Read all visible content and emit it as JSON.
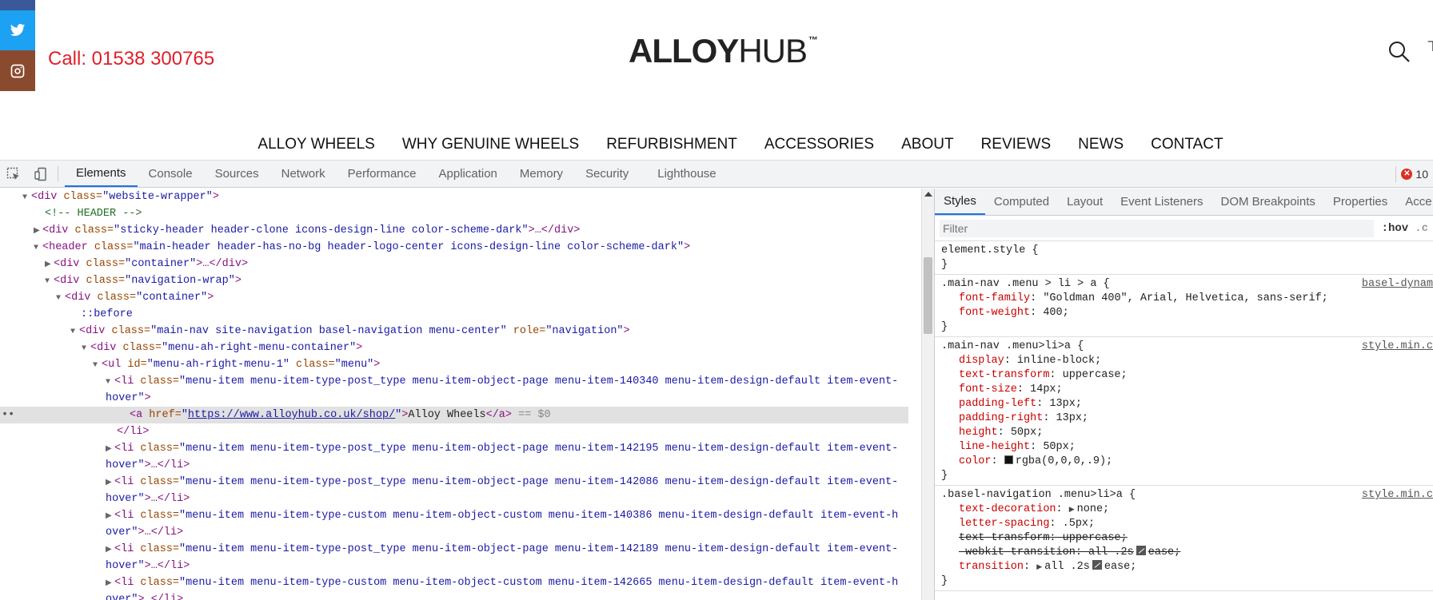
{
  "site": {
    "call_text": "Call: 01538 300765",
    "logo": {
      "bold": "ALLOY",
      "light": "HUB",
      "tm": "™"
    },
    "nav": [
      "ALLOY WHEELS",
      "WHY GENUINE WHEELS",
      "REFURBISHMENT",
      "ACCESSORIES",
      "ABOUT",
      "REVIEWS",
      "NEWS",
      "CONTACT"
    ],
    "social_icons": [
      "facebook-icon",
      "twitter-icon",
      "instagram-icon"
    ]
  },
  "devtools": {
    "tabs": [
      "Elements",
      "Console",
      "Sources",
      "Network",
      "Performance",
      "Application",
      "Memory",
      "Security",
      "Lighthouse"
    ],
    "active_tab": "Elements",
    "error_count": "10",
    "dom": {
      "l1": {
        "tag": "<div",
        "a1": " class=",
        "v1": "\"website-wrapper\"",
        "end": ">"
      },
      "l2": {
        "comment": "<!-- HEADER -->"
      },
      "l3": {
        "tag": "<div",
        "a1": " class=",
        "v1": "\"sticky-header header-clone icons-design-line color-scheme-dark\"",
        "end": ">…</div>"
      },
      "l4": {
        "tag": "<header",
        "a1": " class=",
        "v1": "\"main-header header-has-no-bg header-logo-center icons-design-line color-scheme-dark\"",
        "end": ">"
      },
      "l5": {
        "tag": "<div",
        "a1": " class=",
        "v1": "\"container\"",
        "end": ">…</div>"
      },
      "l6": {
        "tag": "<div",
        "a1": " class=",
        "v1": "\"navigation-wrap\"",
        "end": ">"
      },
      "l7": {
        "tag": "<div",
        "a1": " class=",
        "v1": "\"container\"",
        "end": ">"
      },
      "l8": {
        "pseudo": "::before"
      },
      "l9": {
        "tag": "<div",
        "a1": " class=",
        "v1": "\"main-nav site-navigation basel-navigation menu-center\"",
        "a2": " role=",
        "v2": "\"navigation\"",
        "end": ">"
      },
      "l10": {
        "tag": "<div",
        "a1": " class=",
        "v1": "\"menu-ah-right-menu-container\"",
        "end": ">"
      },
      "l11": {
        "tag": "<ul",
        "a1": " id=",
        "v1": "\"menu-ah-right-menu-1\"",
        "a2": " class=",
        "v2": "\"menu\"",
        "end": ">"
      },
      "l12": {
        "tag": "<li",
        "a1": " class=",
        "v1": "\"menu-item menu-item-type-post_type menu-item-object-page menu-item-140340 menu-item-design-default item-event-"
      },
      "l13": {
        "v1": "hover\"",
        "end": ">"
      },
      "l14": {
        "tag": "<a",
        "a1": " href=",
        "q1": "\"",
        "link": "https://www.alloyhub.co.uk/shop/",
        "q2": "\"",
        "gt": ">",
        "text": "Alloy Wheels",
        "close": "</a>",
        "eq": " == $0"
      },
      "l15": {
        "tag": "</li>"
      },
      "l16": {
        "tag": "<li",
        "a1": " class=",
        "v1": "\"menu-item menu-item-type-post_type menu-item-object-page menu-item-142195 menu-item-design-default item-event-"
      },
      "l17": {
        "v1": "hover\"",
        "end": ">…</li>"
      },
      "l18": {
        "tag": "<li",
        "a1": " class=",
        "v1": "\"menu-item menu-item-type-post_type menu-item-object-page menu-item-142086 menu-item-design-default item-event-"
      },
      "l19": {
        "v1": "hover\"",
        "end": ">…</li>"
      },
      "l20": {
        "tag": "<li",
        "a1": " class=",
        "v1": "\"menu-item menu-item-type-custom menu-item-object-custom menu-item-140386 menu-item-design-default item-event-h"
      },
      "l21": {
        "v1": "over\"",
        "end": ">…</li>"
      },
      "l22": {
        "tag": "<li",
        "a1": " class=",
        "v1": "\"menu-item menu-item-type-post_type menu-item-object-page menu-item-142189 menu-item-design-default item-event-"
      },
      "l23": {
        "v1": "hover\"",
        "end": ">…</li>"
      },
      "l24": {
        "tag": "<li",
        "a1": " class=",
        "v1": "\"menu-item menu-item-type-custom menu-item-object-custom menu-item-142665 menu-item-design-default item-event-h"
      },
      "l25": {
        "v1": "over\"",
        "end": ">…</li>"
      }
    },
    "styles_tabs": [
      "Styles",
      "Computed",
      "Layout",
      "Event Listeners",
      "DOM Breakpoints",
      "Properties",
      "Acce"
    ],
    "filter_placeholder": "Filter",
    "hov": ":hov",
    "hov_more": ".c",
    "rules": {
      "r0": {
        "selector": "element.style {",
        "close": "}"
      },
      "r1": {
        "selector": ".main-nav .menu > li > a {",
        "source": "basel-dynam",
        "p1n": "font-family",
        "p1v": "\"Goldman 400\", Arial, Helvetica, sans-serif;",
        "p2n": "font-weight",
        "p2v": "400;",
        "close": "}"
      },
      "r2": {
        "selector": ".main-nav .menu>li>a {",
        "source": "style.min.c",
        "p1n": "display",
        "p1v": "inline-block;",
        "p2n": "text-transform",
        "p2v": "uppercase;",
        "p3n": "font-size",
        "p3v": "14px;",
        "p4n": "padding-left",
        "p4v": "13px;",
        "p5n": "padding-right",
        "p5v": "13px;",
        "p6n": "height",
        "p6v": "50px;",
        "p7n": "line-height",
        "p7v": "50px;",
        "p8n": "color",
        "p8v": "rgba(0,0,0,.9);",
        "close": "}"
      },
      "r3": {
        "selector": ".basel-navigation .menu>li>a {",
        "source": "style.min.c",
        "p1n": "text-decoration",
        "p1v": "none;",
        "p2n": "letter-spacing",
        "p2v": ".5px;",
        "p3n": "text-transform",
        "p3v": "uppercase;",
        "p4n": "-webkit-transition",
        "p4v": "all .2s",
        "p4e": "ease;",
        "p5n": "transition",
        "p5v": "all .2s",
        "p5e": "ease;",
        "close": "}"
      }
    },
    "colors": {
      "accent": "#1a73e8",
      "call": "#e0202a",
      "twitter": "#1da1f2",
      "instagram": "#8a4a2e",
      "facebook": "#3b5998"
    }
  }
}
